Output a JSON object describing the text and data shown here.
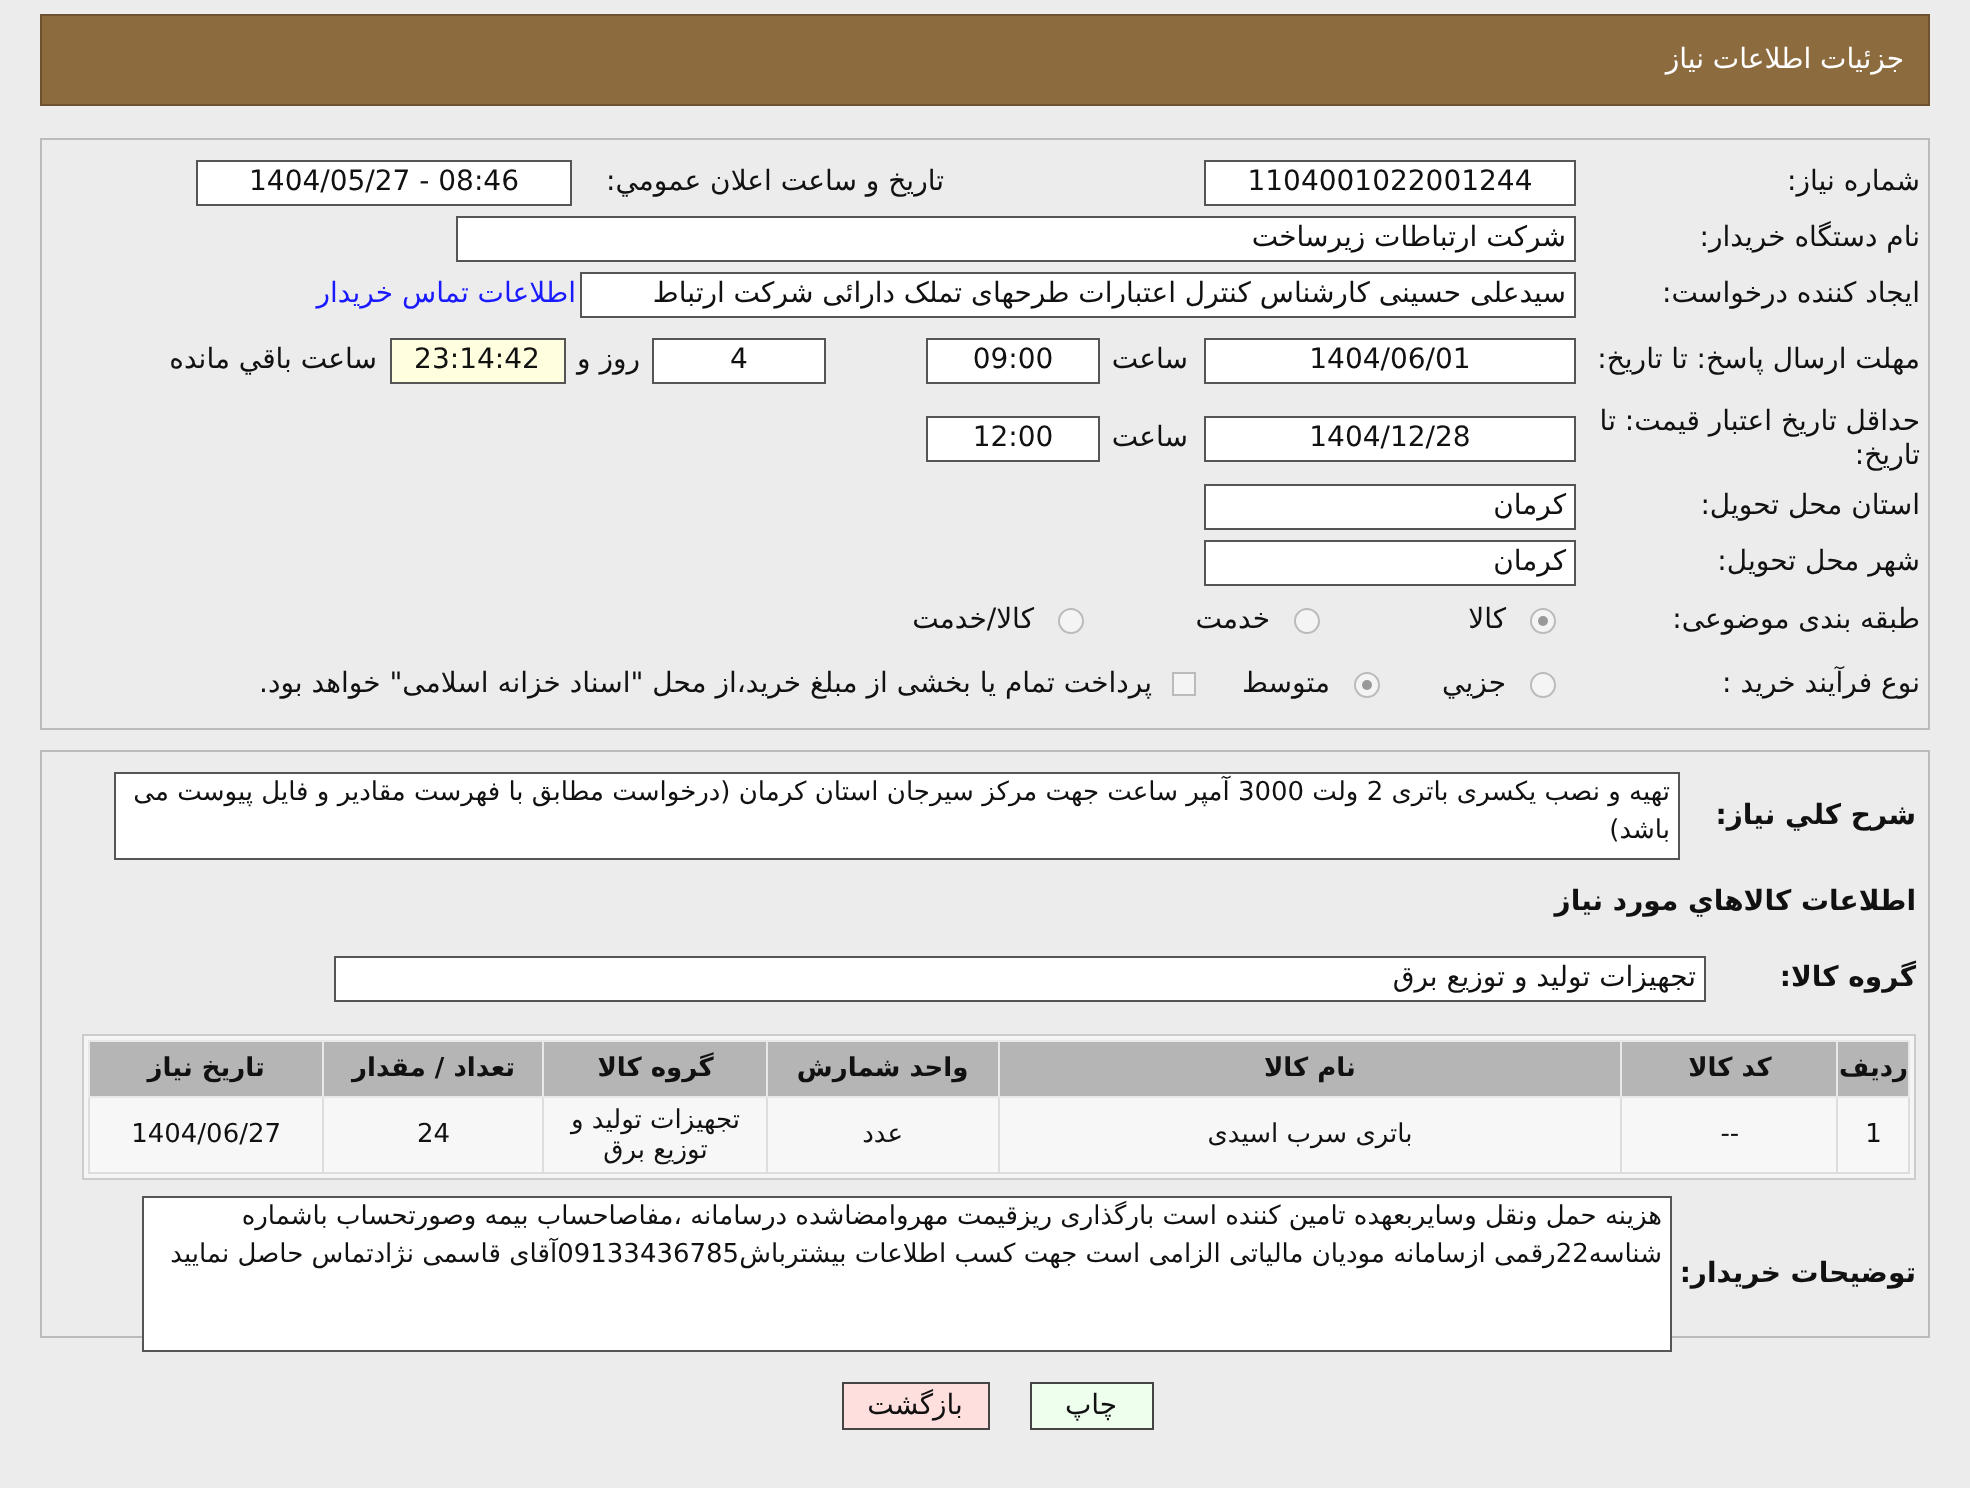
{
  "header": {
    "title": "جزئیات اطلاعات نیاز"
  },
  "need_number": {
    "label": "شماره نیاز:",
    "value": "1104001022001244"
  },
  "announce": {
    "label": "تاریخ و ساعت اعلان عمومي:",
    "value": "1404/05/27 - 08:46"
  },
  "buyer": {
    "label": "نام دستگاه خریدار:",
    "value": "شرکت ارتباطات زیرساخت"
  },
  "creator": {
    "label": "ایجاد کننده درخواست:",
    "value": "سیدعلی حسینی کارشناس کنترل اعتبارات طرحهای تملک دارائی شرکت ارتباط",
    "link": "اطلاعات تماس خریدار"
  },
  "deadline": {
    "label": "مهلت ارسال پاسخ: تا تاریخ:",
    "date": "1404/06/01",
    "time_label": "ساعت",
    "time": "09:00",
    "days": "4",
    "days_label": "روز و",
    "remaining": "23:14:42",
    "remaining_label": "ساعت باقي مانده"
  },
  "validity": {
    "label": "حداقل تاریخ اعتبار قیمت: تا تاریخ:",
    "date": "1404/12/28",
    "time_label": "ساعت",
    "time": "12:00"
  },
  "province": {
    "label": "استان محل تحویل:",
    "value": "کرمان"
  },
  "city": {
    "label": "شهر محل تحویل:",
    "value": "کرمان"
  },
  "category": {
    "label": "طبقه بندی موضوعی:",
    "options": [
      {
        "label": "کالا",
        "selected": true
      },
      {
        "label": "خدمت",
        "selected": false
      },
      {
        "label": "کالا/خدمت",
        "selected": false
      }
    ]
  },
  "process": {
    "label": "نوع فرآیند خرید :",
    "options": [
      {
        "kind": "radio",
        "label": "جزيي",
        "selected": false
      },
      {
        "kind": "radio",
        "label": "متوسط",
        "selected": true
      },
      {
        "kind": "checkbox",
        "label": "پرداخت تمام یا بخشی از مبلغ خرید،از محل \"اسناد خزانه اسلامی\" خواهد بود.",
        "checked": false
      }
    ]
  },
  "description": {
    "label": "شرح کلي نیاز:",
    "value": "تهیه و نصب یکسری باتری 2 ولت 3000 آمپر ساعت جهت مرکز سیرجان استان کرمان (درخواست مطابق با فهرست مقادیر و فایل پیوست می باشد)"
  },
  "goods_heading": "اطلاعات کالاهاي مورد نیاز",
  "goods_group": {
    "label": "گروه کالا:",
    "value": "تجهیزات تولید و توزیع برق"
  },
  "table": {
    "columns": [
      "ردیف",
      "کد کالا",
      "نام کالا",
      "واحد شمارش",
      "گروه کالا",
      "تعداد / مقدار",
      "تاریخ نیاز"
    ],
    "rows": [
      [
        "1",
        "--",
        "باتری سرب اسیدی",
        "عدد",
        "تجهیزات تولید و توزیع برق",
        "24",
        "1404/06/27"
      ]
    ]
  },
  "notes": {
    "label": "توضیحات خریدار:",
    "value": "هزینه حمل ونقل وسایربعهده تامین کننده است بارگذاری ریزقیمت مهروامضاشده درسامانه ،مفاصاحساب بیمه وصورتحساب باشماره شناسه22رقمی ازسامانه مودیان مالیاتی الزامی است جهت کسب اطلاعات بیشترباش09133436785آقای قاسمی نژادتماس حاصل نمایید"
  },
  "buttons": [
    {
      "kind": "print",
      "label": "چاپ"
    },
    {
      "kind": "back",
      "label": "بازگشت"
    }
  ]
}
